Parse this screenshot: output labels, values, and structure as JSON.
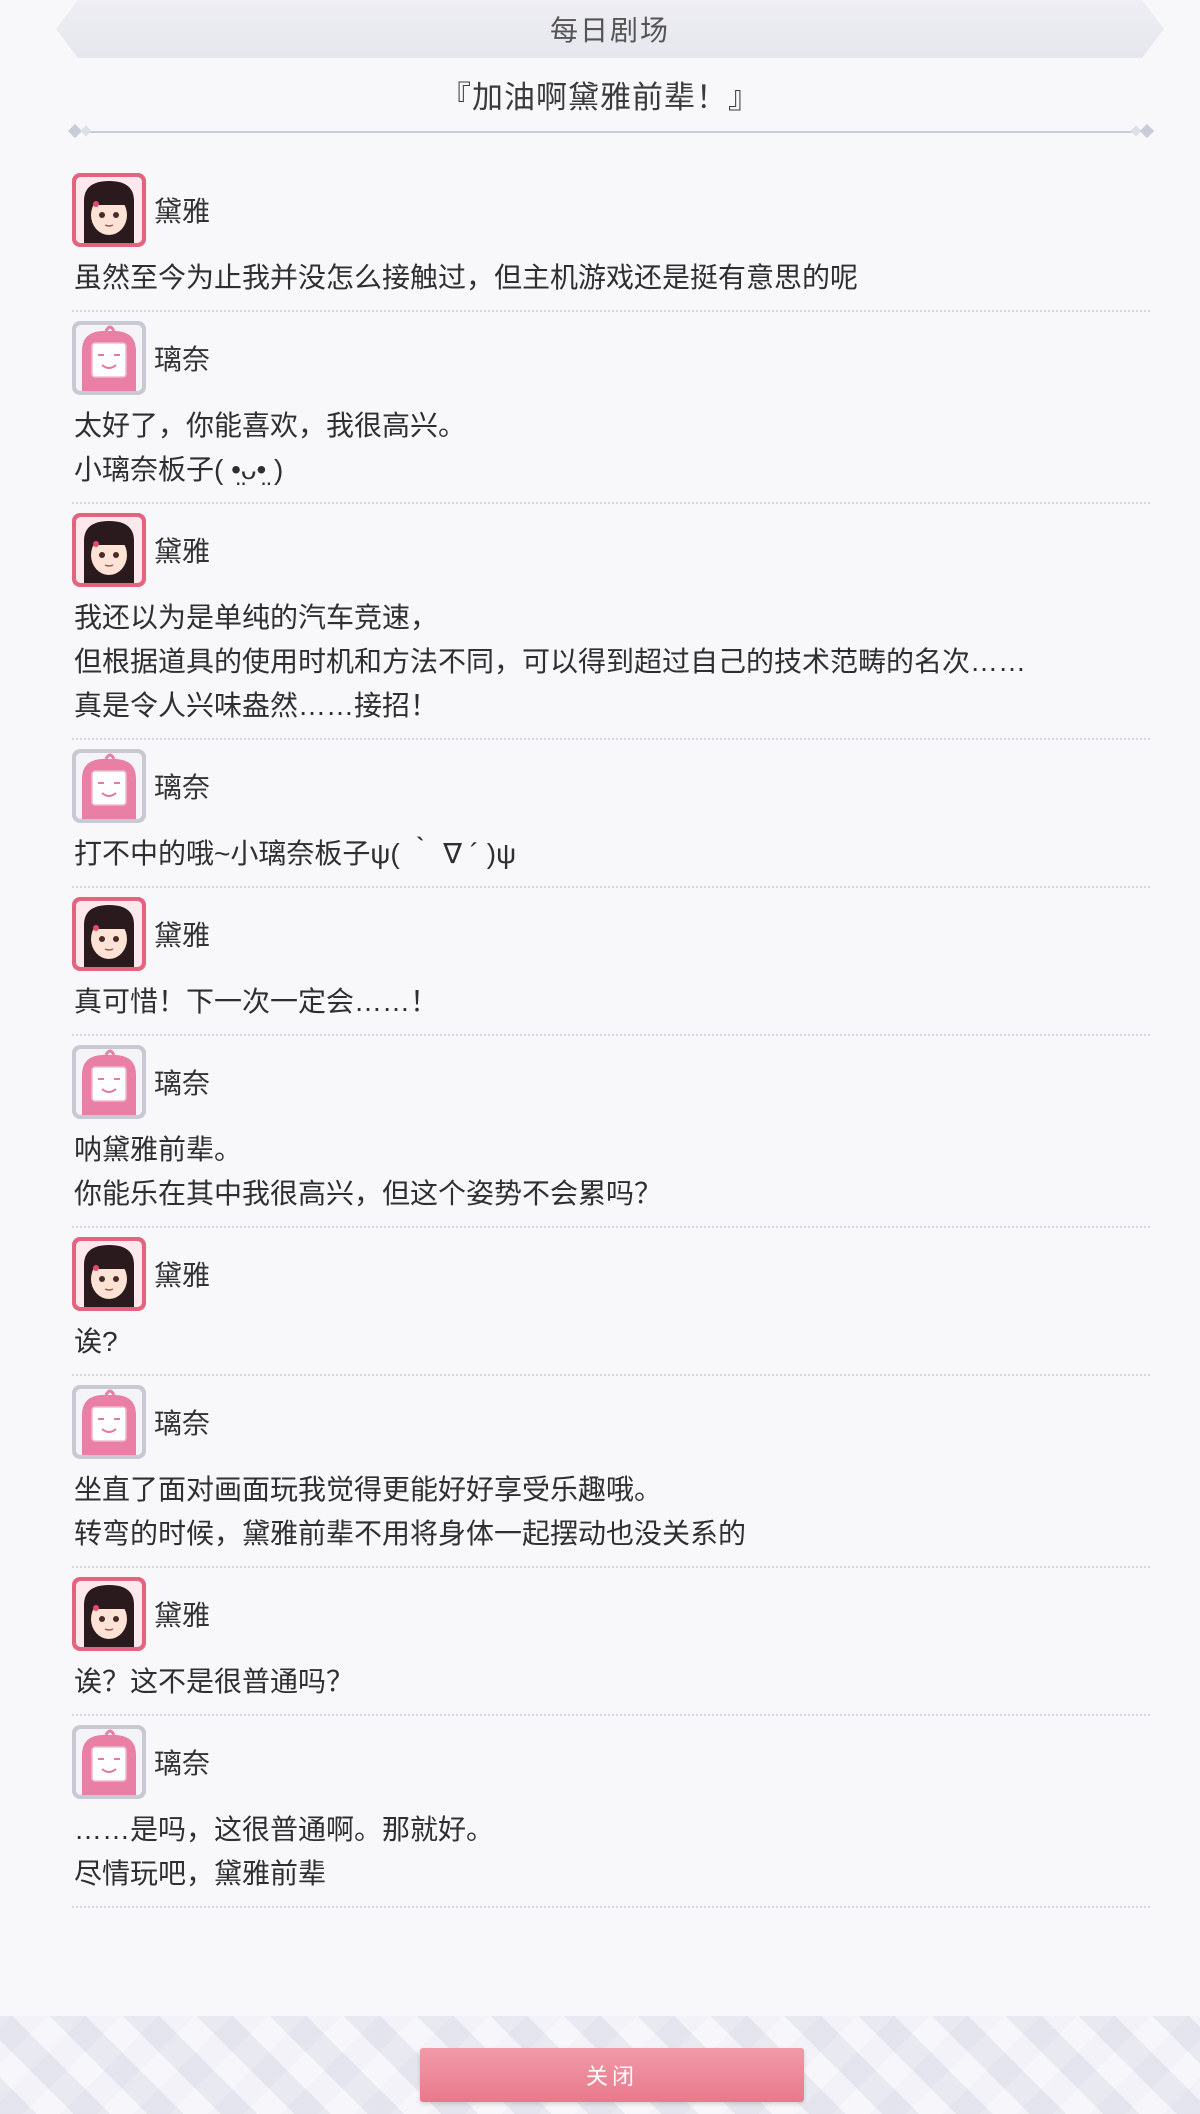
{
  "header": {
    "title": "每日剧场"
  },
  "subtitle": "『加油啊黛雅前辈！』",
  "dialog": [
    {
      "speaker": "黛雅",
      "avatar": "daiya-avatar",
      "lines": [
        "虽然至今为止我并没怎么接触过，但主机游戏还是挺有意思的呢"
      ]
    },
    {
      "speaker": "璃奈",
      "avatar": "rina-avatar",
      "lines": [
        "太好了，你能喜欢，我很高兴。",
        "小璃奈板子( •̤ᴗ•̤ )"
      ]
    },
    {
      "speaker": "黛雅",
      "avatar": "daiya-avatar",
      "lines": [
        "我还以为是单纯的汽车竞速，",
        "但根据道具的使用时机和方法不同，可以得到超过自己的技术范畴的名次……",
        "真是令人兴味盎然……接招！"
      ]
    },
    {
      "speaker": "璃奈",
      "avatar": "rina-avatar",
      "lines": [
        "打不中的哦~小璃奈板子ψ( ｀ ∇ ´ )ψ"
      ]
    },
    {
      "speaker": "黛雅",
      "avatar": "daiya-avatar",
      "lines": [
        "真可惜！下一次一定会……！"
      ]
    },
    {
      "speaker": "璃奈",
      "avatar": "rina-avatar",
      "lines": [
        "呐黛雅前辈。",
        "你能乐在其中我很高兴，但这个姿势不会累吗？"
      ]
    },
    {
      "speaker": "黛雅",
      "avatar": "daiya-avatar",
      "lines": [
        "诶?"
      ]
    },
    {
      "speaker": "璃奈",
      "avatar": "rina-avatar",
      "lines": [
        "坐直了面对画面玩我觉得更能好好享受乐趣哦。",
        "转弯的时候，黛雅前辈不用将身体一起摆动也没关系的"
      ]
    },
    {
      "speaker": "黛雅",
      "avatar": "daiya-avatar",
      "lines": [
        "诶？这不是很普通吗？"
      ]
    },
    {
      "speaker": "璃奈",
      "avatar": "rina-avatar",
      "lines": [
        "……是吗，这很普通啊。那就好。",
        "尽情玩吧，黛雅前辈"
      ]
    }
  ],
  "footer": {
    "close_label": "关闭"
  },
  "colors": {
    "accent": "#e8798c",
    "divider": "#c8ccd8",
    "background": "#f8f8fb"
  }
}
